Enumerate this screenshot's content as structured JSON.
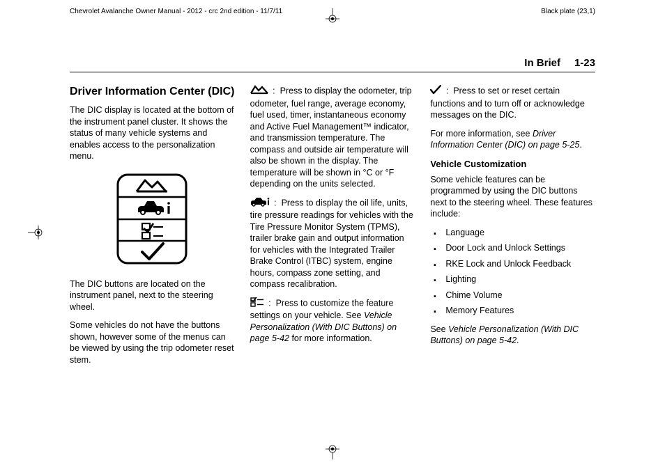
{
  "header": {
    "manual_line": "Chevrolet Avalanche Owner Manual - 2012 - crc 2nd edition - 11/7/11",
    "plate": "Black plate (23,1)"
  },
  "running_head": {
    "section": "In Brief",
    "page": "1-23"
  },
  "col1": {
    "title": "Driver Information Center (DIC)",
    "p1": "The DIC display is located at the bottom of the instrument panel cluster. It shows the status of many vehicle systems and enables access to the personalization menu.",
    "p2": "The DIC buttons are located on the instrument panel, next to the steering wheel.",
    "p3": "Some vehicles do not have the buttons shown, however some of the menus can be viewed by using the trip odometer reset stem."
  },
  "col2": {
    "b1_lead": ":",
    "b1_body": "Press to display the odometer, trip odometer, fuel range, average economy, fuel used, timer, instantaneous economy and Active Fuel Management™ indicator, and transmission temperature. The compass and outside air temperature will also be shown in the display. The temperature will be shown in °C or °F depending on the units selected.",
    "b2_lead": ":",
    "b2_body": "Press to display the oil life, units, tire pressure readings for vehicles with the Tire Pressure Monitor System (TPMS), trailer brake gain and output information for vehicles with the Integrated Trailer Brake Control (ITBC) system, engine hours, compass zone setting, and compass recalibration.",
    "b3_lead": ":",
    "b3_body_a": "Press to customize the feature settings on your vehicle. See ",
    "b3_ref": "Vehicle Personalization (With DIC Buttons) on page 5-42",
    "b3_body_b": " for more information."
  },
  "col3": {
    "check_lead": ":",
    "check_body": "Press to set or reset certain functions and to turn off or acknowledge messages on the DIC.",
    "more_a": "For more information, see ",
    "more_ref": "Driver Information Center (DIC) on page 5-25",
    "more_b": ".",
    "vc_title": "Vehicle Customization",
    "vc_intro": "Some vehicle features can be programmed by using the DIC buttons next to the steering wheel. These features include:",
    "features": [
      "Language",
      "Door Lock and Unlock Settings",
      "RKE Lock and Unlock Feedback",
      "Lighting",
      "Chime Volume",
      "Memory Features"
    ],
    "see_a": "See ",
    "see_ref": "Vehicle Personalization (With DIC Buttons) on page 5-42",
    "see_b": "."
  }
}
